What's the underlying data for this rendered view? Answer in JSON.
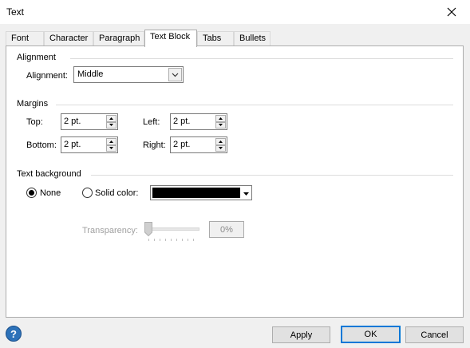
{
  "window": {
    "title": "Text",
    "close_icon": "close-icon"
  },
  "tabs": [
    {
      "label": "Font",
      "active": false
    },
    {
      "label": "Character",
      "active": false
    },
    {
      "label": "Paragraph",
      "active": false
    },
    {
      "label": "Text Block",
      "active": true
    },
    {
      "label": "Tabs",
      "active": false
    },
    {
      "label": "Bullets",
      "active": false
    }
  ],
  "alignment": {
    "section_title": "Alignment",
    "label": "Alignment:",
    "value": "Middle"
  },
  "margins": {
    "section_title": "Margins",
    "top": {
      "label": "Top:",
      "value": "2 pt."
    },
    "bottom": {
      "label": "Bottom:",
      "value": "2 pt."
    },
    "left": {
      "label": "Left:",
      "value": "2 pt."
    },
    "right": {
      "label": "Right:",
      "value": "2 pt."
    }
  },
  "background": {
    "section_title": "Text background",
    "none_label": "None",
    "none_selected": true,
    "solid_label": "Solid color:",
    "solid_selected": false,
    "solid_color": "#000000",
    "transparency_label": "Transparency:",
    "transparency_value": "0%",
    "transparency_fraction": 0
  },
  "footer": {
    "help_label": "?",
    "apply_label": "Apply",
    "ok_label": "OK",
    "cancel_label": "Cancel"
  }
}
